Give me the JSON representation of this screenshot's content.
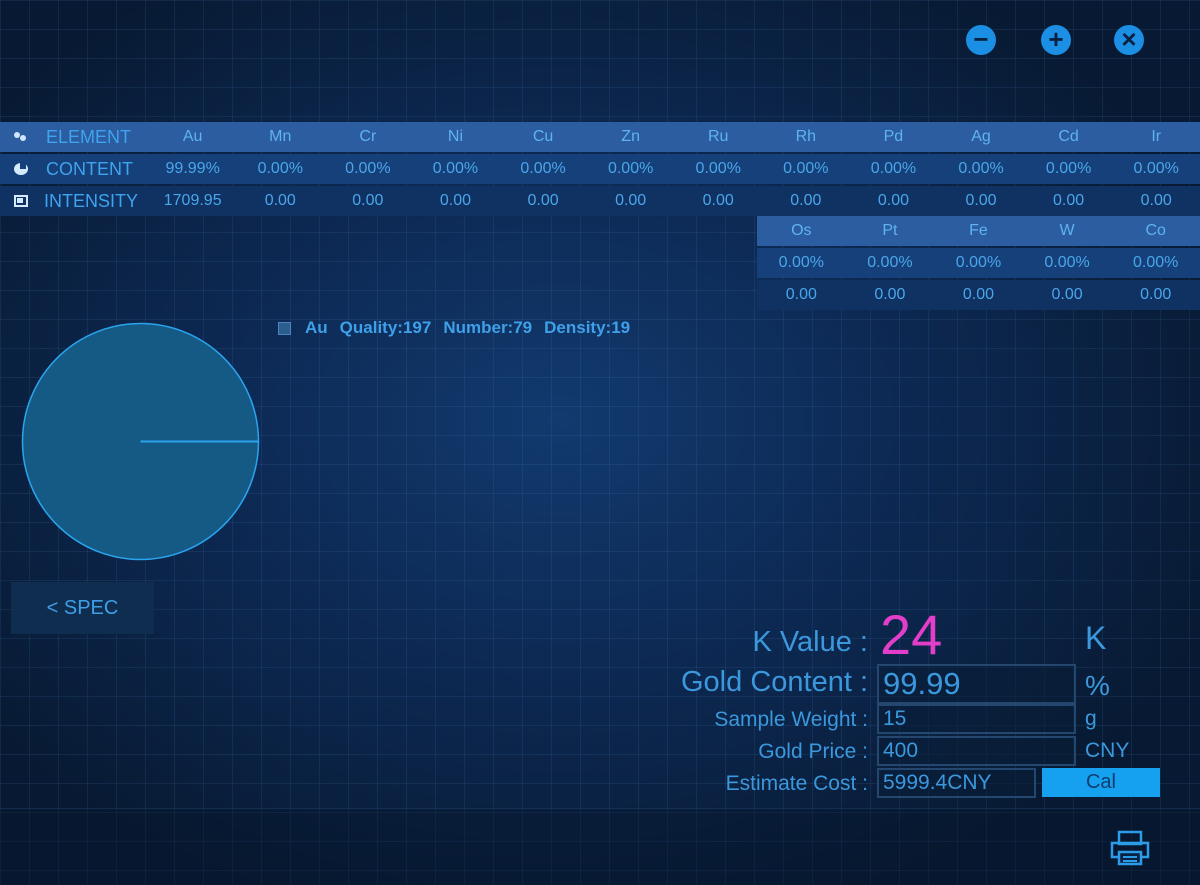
{
  "window_controls": {
    "minimize": "−",
    "maximize": "+",
    "close": "×",
    "color": "#1a8fe4"
  },
  "element_table": {
    "row_labels": {
      "element": "ELEMENT",
      "content": "CONTENT",
      "intensity": "INTENSITY"
    },
    "icons": {
      "element": "molecule-icon",
      "content": "pie-icon",
      "intensity": "intensity-icon"
    },
    "primary": {
      "elements": [
        "Au",
        "Mn",
        "Cr",
        "Ni",
        "Cu",
        "Zn",
        "Ru",
        "Rh",
        "Pd",
        "Ag",
        "Cd",
        "Ir"
      ],
      "content": [
        "99.99%",
        "0.00%",
        "0.00%",
        "0.00%",
        "0.00%",
        "0.00%",
        "0.00%",
        "0.00%",
        "0.00%",
        "0.00%",
        "0.00%",
        "0.00%"
      ],
      "intensity": [
        "1709.95",
        "0.00",
        "0.00",
        "0.00",
        "0.00",
        "0.00",
        "0.00",
        "0.00",
        "0.00",
        "0.00",
        "0.00",
        "0.00"
      ]
    },
    "secondary": {
      "elements": [
        "Os",
        "Pt",
        "Fe",
        "W",
        "Co"
      ],
      "content": [
        "0.00%",
        "0.00%",
        "0.00%",
        "0.00%",
        "0.00%"
      ],
      "intensity": [
        "0.00",
        "0.00",
        "0.00",
        "0.00",
        "0.00"
      ]
    }
  },
  "legend": {
    "element": "Au",
    "quality": "Quality:197",
    "number": "Number:79",
    "density": "Density:19"
  },
  "pie": {
    "slice_fraction": 1.0,
    "fill_color": "#155a85",
    "line_color": "#2aa4ee"
  },
  "spec_button": "< SPEC",
  "form": {
    "k_label": "K Value :",
    "k_value": "24",
    "k_unit": "K",
    "gold_label": "Gold Content :",
    "gold_value": "99.99",
    "gold_unit": "%",
    "weight_label": "Sample Weight :",
    "weight_value": "15",
    "weight_unit": "g",
    "price_label": "Gold Price :",
    "price_value": "400",
    "price_unit": "CNY",
    "cost_label": "Estimate Cost :",
    "cost_value": "5999.4CNY",
    "cal_label": "Cal"
  },
  "accent_colors": {
    "k_value": "#e23ec9",
    "text": "#3b98dd",
    "button": "#16a0f0"
  }
}
